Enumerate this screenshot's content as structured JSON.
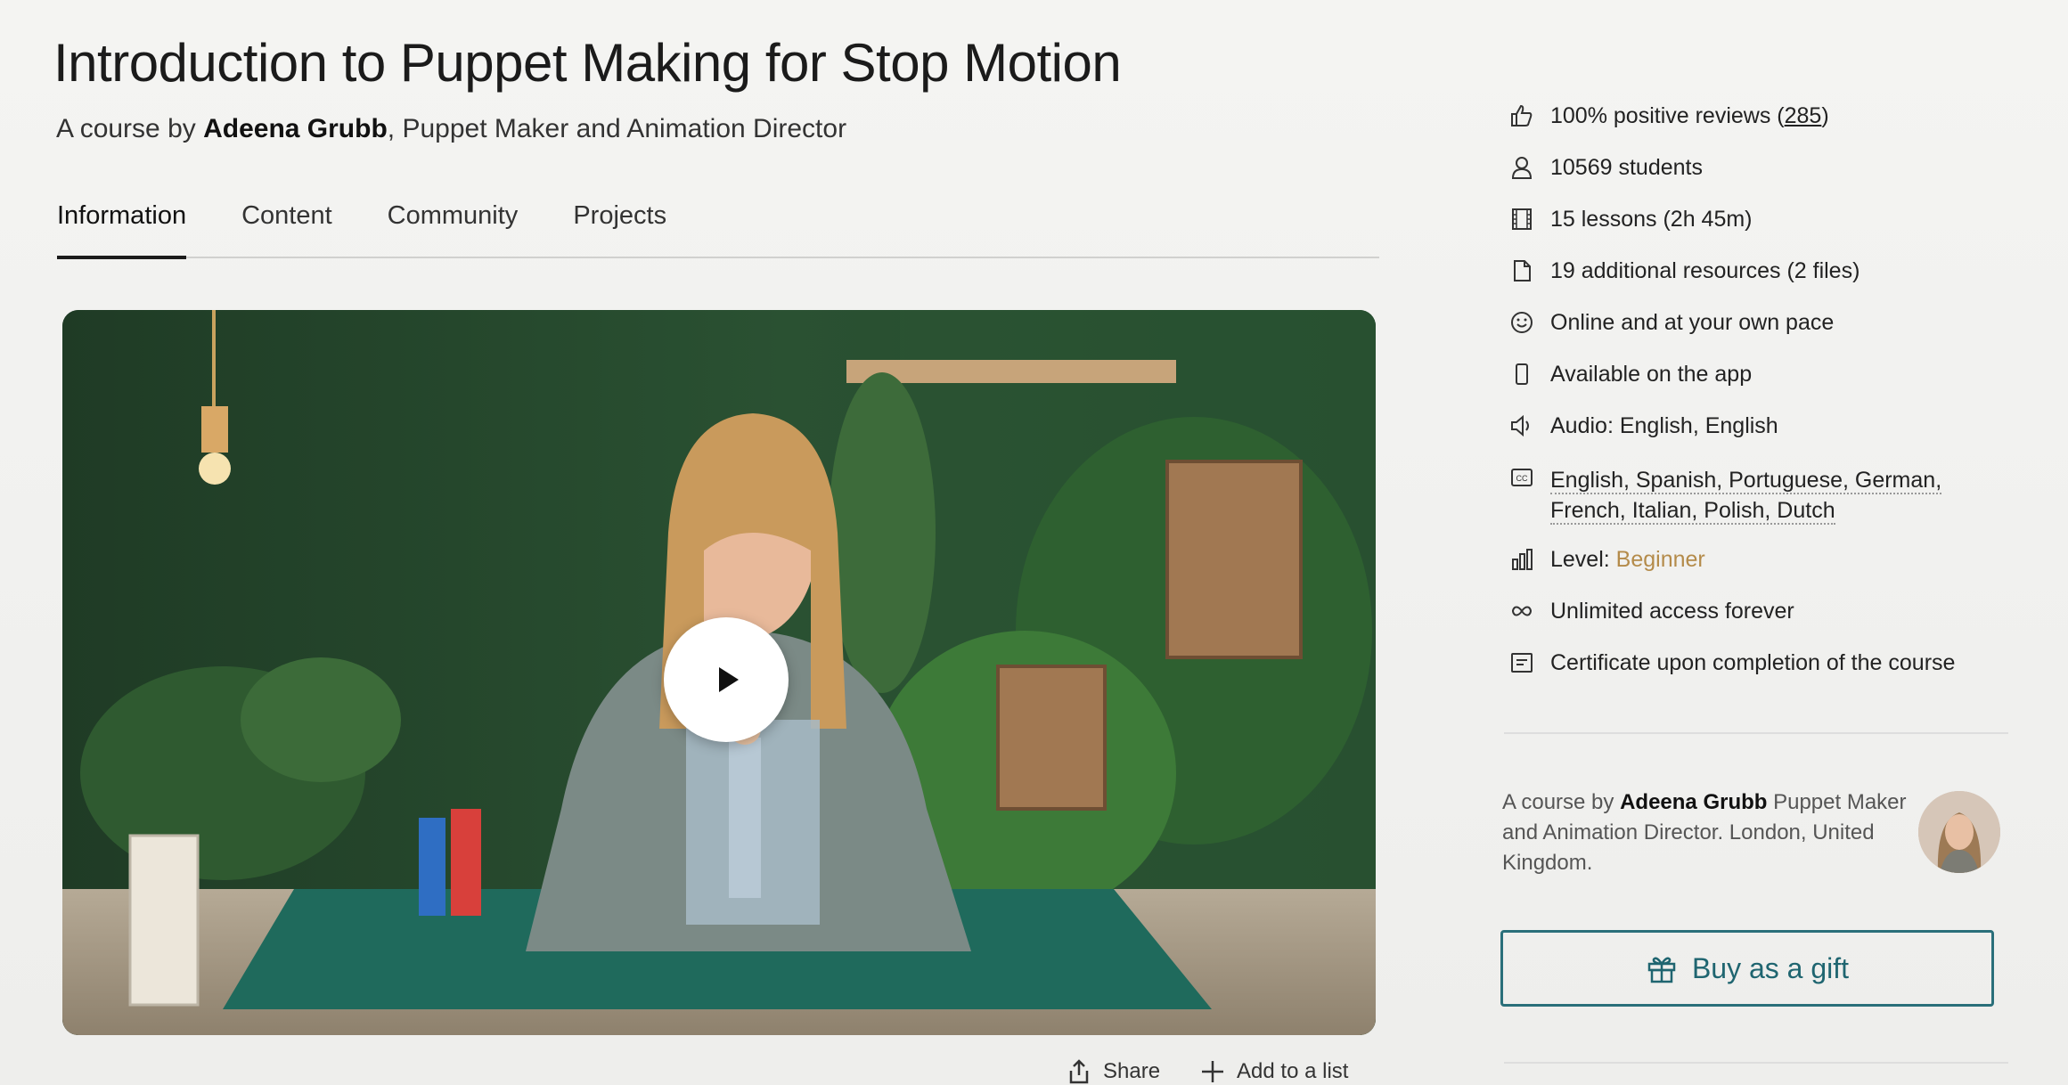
{
  "course": {
    "title": "Introduction to Puppet Making for Stop Motion",
    "subtitle_prefix": "A course by ",
    "author": "Adeena Grubb",
    "subtitle_suffix": ", Puppet Maker and Animation Director"
  },
  "tabs": [
    {
      "label": "Information",
      "active": true
    },
    {
      "label": "Content",
      "active": false
    },
    {
      "label": "Community",
      "active": false
    },
    {
      "label": "Projects",
      "active": false
    }
  ],
  "video": {
    "play_icon": "play-icon"
  },
  "actions": {
    "share_label": "Share",
    "add_to_list_label": "Add to a list"
  },
  "info": {
    "reviews_prefix": "100% positive reviews (",
    "reviews_count": "285",
    "reviews_suffix": ")",
    "students": "10569 students",
    "lessons": "15 lessons (2h 45m)",
    "resources": "19 additional resources (2 files)",
    "pace": "Online and at your own pace",
    "app": "Available on the app",
    "audio": "Audio: English, English",
    "subtitles_line1": "English, Spanish, Portuguese, German,",
    "subtitles_line2": "French, Italian, Polish, Dutch",
    "level_label": "Level: ",
    "level_value": "Beginner",
    "access": "Unlimited access forever",
    "certificate": "Certificate upon completion of the course"
  },
  "byline": {
    "prefix": "A course by ",
    "author": "Adeena Grubb",
    "suffix": " Puppet Maker and Animation Director. London, United Kingdom."
  },
  "gift_button": {
    "label": "Buy as a gift",
    "icon": "gift-icon"
  },
  "colors": {
    "accent": "#1f6570",
    "level": "#b48b4a",
    "video_bg": "#1f3d2a"
  }
}
